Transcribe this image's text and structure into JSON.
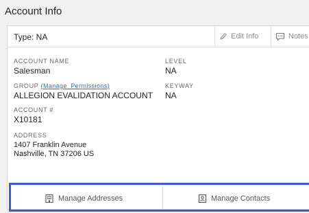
{
  "panel": {
    "title": "Account Info"
  },
  "header": {
    "type_label": "Type: NA",
    "edit_info": "Edit Info",
    "notes": "Notes"
  },
  "fields": {
    "account_name_label": "ACCOUNT NAME",
    "account_name_value": "Salesman",
    "level_label": "LEVEL",
    "level_value": "NA",
    "group_label": "GROUP",
    "manage_permissions": "(Manage_Permissions)",
    "group_value": "ALLEGION EVALIDATION ACCOUNT",
    "keyway_label": "KEYWAY",
    "keyway_value": "NA",
    "account_number_label": "ACCOUNT #",
    "account_number_value": "X10181",
    "address_label": "ADDRESS",
    "address_line1": "1407 Franklin Avenue",
    "address_line2": "Nashville, TN 37206 US"
  },
  "footer": {
    "manage_addresses": "Manage Addresses",
    "manage_contacts": "Manage Contacts"
  },
  "icons": {
    "edit": "pencil-icon",
    "notes": "comment-icon",
    "addresses": "building-icon",
    "contacts": "contact-card-icon"
  },
  "colors": {
    "accent": "#3b5bdb",
    "link": "#2f6fd0"
  }
}
